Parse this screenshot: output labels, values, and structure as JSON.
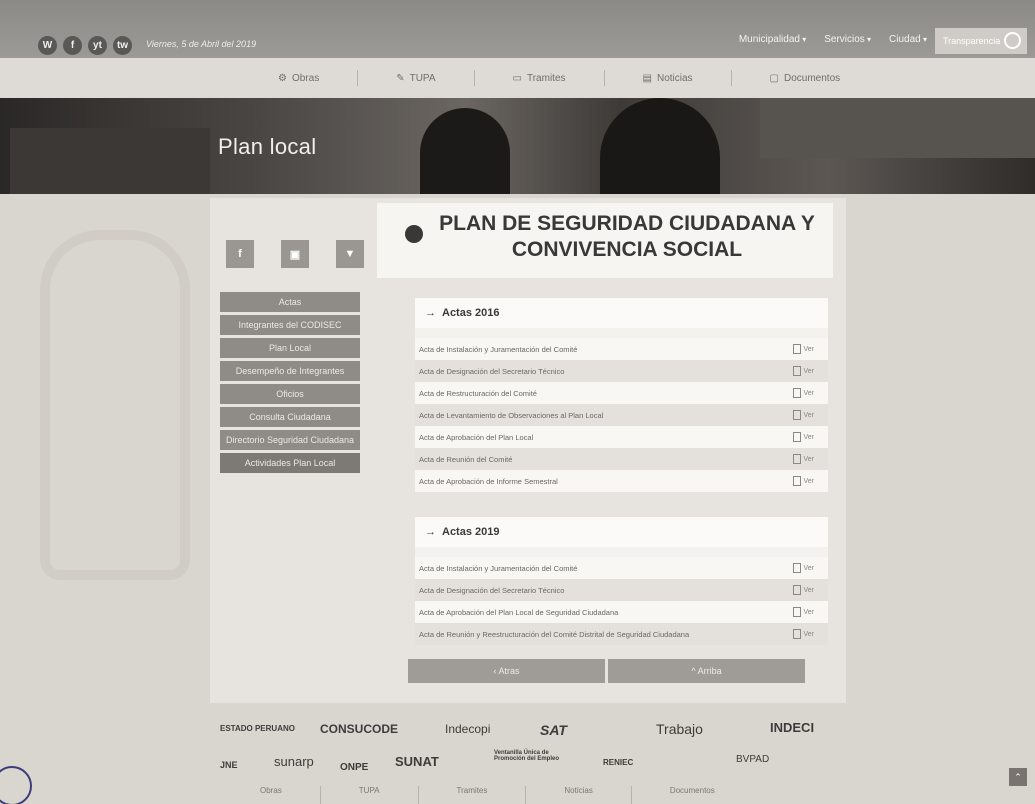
{
  "header": {
    "social": [
      "W",
      "f",
      "yt",
      "tw"
    ],
    "social_names": [
      "whatsapp-icon",
      "facebook-icon",
      "youtube-icon",
      "twitter-icon"
    ],
    "date": "Viernes, 5 de Abril del 2019",
    "nav": [
      "Municipalidad",
      "Servicios",
      "Ciudad"
    ],
    "transparency": "Transparencia"
  },
  "subnav": [
    {
      "icon": "⚙",
      "label": "Obras"
    },
    {
      "icon": "✎",
      "label": "TUPA"
    },
    {
      "icon": "▭",
      "label": "Tramites"
    },
    {
      "icon": "▤",
      "label": "Noticias"
    },
    {
      "icon": "▢",
      "label": "Documentos"
    }
  ],
  "banner": {
    "title": "Plan local"
  },
  "sidebar": {
    "share": [
      "f",
      "▣",
      "▼"
    ],
    "items": [
      "Actas",
      "Integrantes del CODISEC",
      "Plan Local",
      "Desempeño de Integrantes",
      "Oficios",
      "Consulta Ciudadana",
      "Directorio Seguridad Ciudadana",
      "Actividades Plan Local"
    ]
  },
  "main": {
    "title": "PLAN DE SEGURIDAD CIUDADANA Y CONVIVENCIA SOCIAL",
    "ver_label": "Ver",
    "panels": [
      {
        "heading": "Actas 2016",
        "rows": [
          "Acta de Instalación y Juramentación del Comité",
          "Acta de Designación del Secretario Técnico",
          "Acta de Restructuración del Comité",
          "Acta de Levantamiento de Observaciones al Plan Local",
          "Acta de Aprobación del Plan Local",
          "Acta de Reunión del Comité",
          "Acta de Aprobación de Informe Semestral"
        ]
      },
      {
        "heading": "Actas 2019",
        "rows": [
          "Acta de Instalación y Juramentación del Comité",
          "Acta de Designación del Secretario Técnico",
          "Acta de Aprobación del Plan Local de Seguridad Ciudadana",
          "Acta de Reunión y Reestructuración del Comité Distrital de Seguridad Ciudadana"
        ]
      }
    ],
    "back_label": "‹ Atras",
    "up_label": "^ Arriba"
  },
  "footer": {
    "logos": [
      "ESTADO PERUANO",
      "CONSUCODE",
      "Indecopi",
      "SAT",
      "Trabajo",
      "INDECI",
      "JNE",
      "sunarp",
      "ONPE",
      "SUNAT",
      "Ventanilla Única de Promoción del Empleo",
      "RENIEC",
      "BVPAD"
    ],
    "nav": [
      "Obras",
      "TUPA",
      "Tramites",
      "Noticias",
      "Documentos"
    ]
  }
}
